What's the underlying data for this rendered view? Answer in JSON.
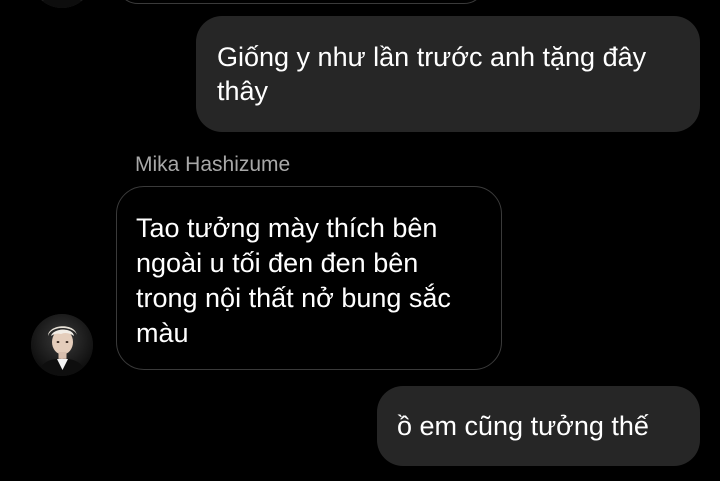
{
  "conversation": {
    "messages": [
      {
        "direction": "outgoing",
        "text": "Giống y như lần trước anh tặng đây thây"
      },
      {
        "direction": "incoming",
        "sender": "Mika Hashizume",
        "text": "Tao tưởng mày thích bên ngoài u tối đen đen bên trong nội thất nở bung sắc màu"
      },
      {
        "direction": "outgoing",
        "text": "ồ em cũng tưởng thế"
      }
    ]
  },
  "theme": {
    "background": "#000000",
    "sent_bubble": "#262626",
    "received_border": "#3a3a3a",
    "sender_name_color": "#a8a8a8",
    "text_color": "#ffffff"
  },
  "icons": {
    "avatar": "user-avatar-photo"
  }
}
